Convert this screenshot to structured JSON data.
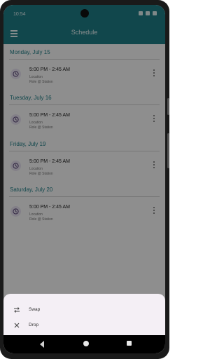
{
  "status_bar": {
    "time": "10:54"
  },
  "app_bar": {
    "title": "Schedule"
  },
  "days": [
    {
      "header": "Monday, July 15",
      "shift": {
        "time": "5:00 PM - 2:45 AM",
        "location": "Location",
        "role": "Role @ Station"
      }
    },
    {
      "header": "Tuesday, July 16",
      "shift": {
        "time": "5:00 PM - 2:45 AM",
        "location": "Location",
        "role": "Role @ Station"
      }
    },
    {
      "header": "Friday, July 19",
      "shift": {
        "time": "5:00 PM - 2:45 AM",
        "location": "Location",
        "role": "Role @ Station"
      }
    },
    {
      "header": "Saturday, July 20",
      "shift": {
        "time": "5:00 PM - 2:45 AM",
        "location": "Location",
        "role": "Role @ Station"
      }
    }
  ],
  "bottom_sheet": {
    "items": [
      {
        "label": "Swap",
        "icon": "swap-icon"
      },
      {
        "label": "Drop",
        "icon": "close-icon"
      }
    ]
  },
  "colors": {
    "primary": "#1f7d86",
    "sheet_bg": "#f4eff5",
    "scrim": "rgba(0,0,0,0.43)"
  }
}
